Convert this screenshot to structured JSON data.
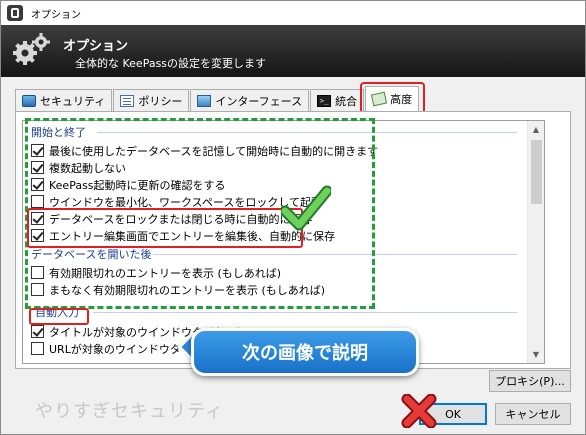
{
  "window": {
    "title": "オプション"
  },
  "banner": {
    "title": "オプション",
    "subtitle": "全体的な KeePassの設定を変更します"
  },
  "tabs": [
    {
      "label": "セキュリティ",
      "icon": "shield-icon"
    },
    {
      "label": "ポリシー",
      "icon": "policy-list-icon"
    },
    {
      "label": "インターフェース",
      "icon": "interface-window-icon"
    },
    {
      "label": "統合",
      "icon": "terminal-icon"
    },
    {
      "label": "高度",
      "icon": "advanced-settings-icon",
      "active": true
    }
  ],
  "groups": [
    {
      "header": "開始と終了",
      "items": [
        {
          "label": "最後に使用したデータベースを記憶して開始時に自動的に開きます",
          "checked": true
        },
        {
          "label": "複数起動しない",
          "checked": true
        },
        {
          "label": "KeePass起動時に更新の確認をする",
          "checked": true
        },
        {
          "label": "ウインドウを最小化、ワークスペースをロックして起動",
          "checked": false
        },
        {
          "label": "データベースをロックまたは閉じる時に自動的に保存",
          "checked": true
        },
        {
          "label": "エントリー編集画面でエントリーを編集後、自動的に保存",
          "checked": true
        }
      ]
    },
    {
      "header": "データベースを開いた後",
      "items": [
        {
          "label": "有効期限切れのエントリーを表示 (もしあれば)",
          "checked": false
        },
        {
          "label": "まもなく有効期限切れのエントリーを表示 (もしあれば)",
          "checked": false
        }
      ]
    },
    {
      "header": "自動入力",
      "items": [
        {
          "label": "タイトルが対象のウインドウタイトルに",
          "checked": true
        },
        {
          "label": "URLが対象のウインドウタイトルに",
          "checked": false
        }
      ]
    }
  ],
  "callout": {
    "text": "次の画像で説明"
  },
  "buttons": {
    "proxy": "プロキシ(P)...",
    "ok": "OK",
    "cancel": "キャンセル"
  },
  "watermark": "やりすぎセキュリティ",
  "colors": {
    "highlight_red": "#e02020",
    "highlight_green": "#1fa03a",
    "callout_blue": "#1872c8"
  }
}
